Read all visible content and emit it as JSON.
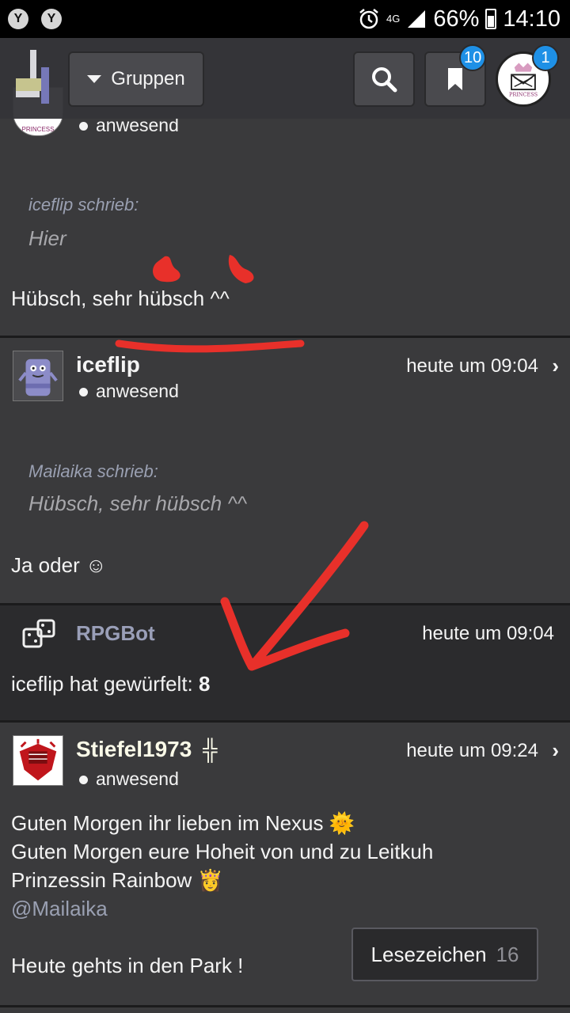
{
  "status_bar": {
    "notif1": "Y",
    "notif2": "Y",
    "network": "4G",
    "battery": "66%",
    "time": "14:10"
  },
  "nav": {
    "groups_label": "Gruppen",
    "bookmarks_badge": "10",
    "profile_badge": "1",
    "profile_avatar_text": "PRINCESS"
  },
  "posts": [
    {
      "status": "anwesend",
      "quote_author": "iceflip schrieb:",
      "quote_text": "Hier",
      "body": "Hübsch, sehr hübsch ^^"
    },
    {
      "user": "iceflip",
      "status": "anwesend",
      "time": "heute um 09:04",
      "quote_author": "Mailaika schrieb:",
      "quote_text": "Hübsch, sehr hübsch ^^",
      "body": "Ja oder ☺"
    },
    {
      "user": "RPGBot",
      "time": "heute um 09:04",
      "body_prefix": "iceflip hat gewürfelt: ",
      "body_value": "8"
    },
    {
      "user": "Stiefel1973",
      "user_badge": "╬",
      "status": "anwesend",
      "time": "heute um 09:24",
      "line1": "Guten Morgen ihr lieben im Nexus 🌞",
      "line2": "Guten Morgen eure Hoheit von und zu Leitkuh",
      "line3": "Prinzessin Rainbow 👸",
      "mention": "@Mailaika",
      "line4": "Heute gehts in den Park !"
    }
  ],
  "bookmark_button": {
    "label": "Lesezeichen",
    "count": "16"
  },
  "colors": {
    "background": "#3a3a3c",
    "bot_background": "#2b2b2d",
    "badge": "#1e90e6",
    "mention": "#9aa0b2",
    "annotation_red": "#e8302a"
  }
}
